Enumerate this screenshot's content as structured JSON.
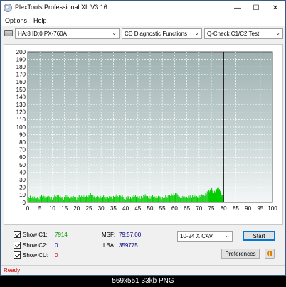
{
  "window": {
    "title": "PlexTools Professional XL V3.16"
  },
  "menu": {
    "options": "Options",
    "help": "Help"
  },
  "toolbar": {
    "drive": "HA:8 ID:0  PX-760A",
    "function": "CD Diagnostic Functions",
    "test": "Q-Check C1/C2 Test"
  },
  "chart_data": {
    "type": "area",
    "xlabel": "",
    "ylabel": "",
    "xlim": [
      0,
      100
    ],
    "ylim": [
      0,
      200
    ],
    "x_ticks": [
      "0",
      "5",
      "10",
      "15",
      "20",
      "25",
      "30",
      "35",
      "40",
      "45",
      "50",
      "55",
      "60",
      "65",
      "70",
      "75",
      "80",
      "85",
      "90",
      "95",
      "100"
    ],
    "y_ticks": [
      "0",
      "10",
      "20",
      "30",
      "40",
      "50",
      "60",
      "70",
      "80",
      "90",
      "100",
      "110",
      "120",
      "130",
      "140",
      "150",
      "160",
      "170",
      "180",
      "190",
      "200"
    ],
    "grid": true,
    "end_marker_x": 80,
    "series": [
      {
        "color": "#00cc00",
        "x": [
          0,
          2,
          4,
          6,
          8,
          10,
          12,
          14,
          16,
          18,
          20,
          22,
          24,
          26,
          28,
          30,
          32,
          34,
          36,
          38,
          40,
          42,
          44,
          46,
          48,
          50,
          52,
          54,
          56,
          58,
          60,
          62,
          64,
          66,
          68,
          70,
          72,
          74,
          75,
          76,
          77,
          78,
          79,
          80
        ],
        "y": [
          6,
          8,
          5,
          9,
          7,
          6,
          10,
          5,
          8,
          7,
          6,
          9,
          7,
          11,
          6,
          8,
          7,
          6,
          9,
          8,
          6,
          7,
          8,
          6,
          10,
          7,
          8,
          6,
          7,
          9,
          12,
          8,
          6,
          7,
          9,
          8,
          10,
          14,
          18,
          12,
          16,
          20,
          10,
          8
        ]
      }
    ]
  },
  "stats": {
    "show_c1": "Show C1:",
    "c1_value": "7914",
    "show_c2": "Show C2:",
    "c2_value": "0",
    "show_cu": "Show CU:",
    "cu_value": "0",
    "msf_label": "MSF:",
    "msf_value": "79:57.00",
    "lba_label": "LBA:",
    "lba_value": "359775"
  },
  "controls": {
    "speed": "10-24 X CAV",
    "start": "Start",
    "preferences": "Preferences",
    "info": "i"
  },
  "status": {
    "text": "Ready"
  },
  "caption": "569x551 33kb PNG"
}
